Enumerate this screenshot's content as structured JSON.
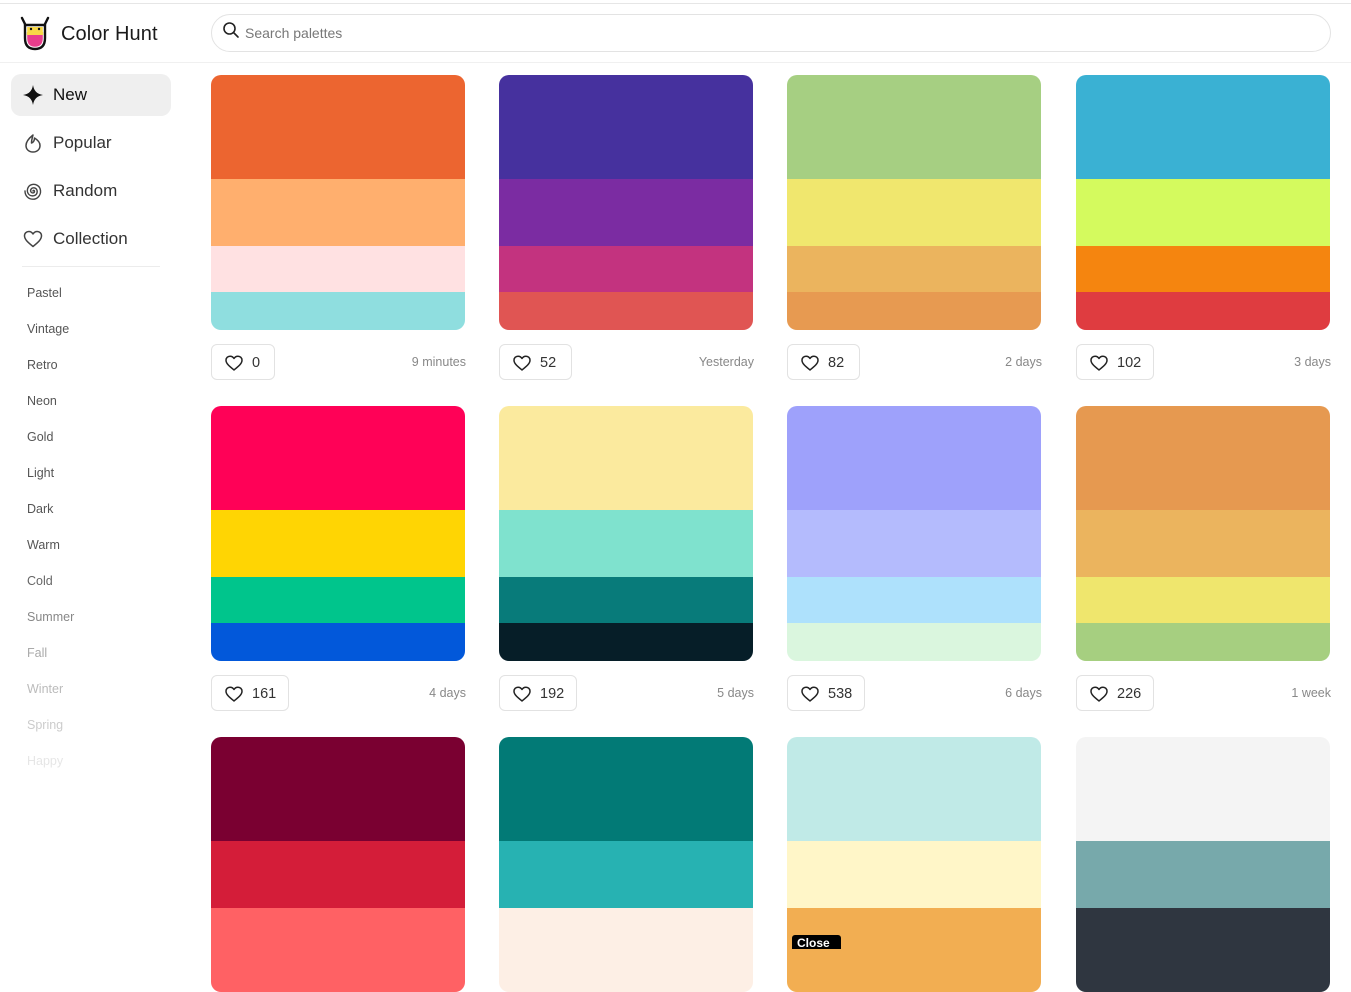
{
  "app": {
    "brand": "Color Hunt"
  },
  "search": {
    "placeholder": "Search palettes"
  },
  "sidebar": {
    "nav": [
      {
        "label": "New",
        "icon": "sparkle-icon",
        "active": true
      },
      {
        "label": "Popular",
        "icon": "flame-icon",
        "active": false
      },
      {
        "label": "Random",
        "icon": "spiral-icon",
        "active": false
      },
      {
        "label": "Collection",
        "icon": "heart-icon",
        "active": false
      }
    ],
    "tags": [
      {
        "label": "Pastel",
        "color": "#555555"
      },
      {
        "label": "Vintage",
        "color": "#555555"
      },
      {
        "label": "Retro",
        "color": "#555555"
      },
      {
        "label": "Neon",
        "color": "#555555"
      },
      {
        "label": "Gold",
        "color": "#555555"
      },
      {
        "label": "Light",
        "color": "#555555"
      },
      {
        "label": "Dark",
        "color": "#555555"
      },
      {
        "label": "Warm",
        "color": "#555555"
      },
      {
        "label": "Cold",
        "color": "#666666"
      },
      {
        "label": "Summer",
        "color": "#888888"
      },
      {
        "label": "Fall",
        "color": "#aaaaaa"
      },
      {
        "label": "Winter",
        "color": "#bbbbbb"
      },
      {
        "label": "Spring",
        "color": "#cccccc"
      },
      {
        "label": "Happy",
        "color": "#e6e6e6"
      }
    ]
  },
  "palettes": [
    {
      "colors": [
        "#EC6530",
        "#FFAF6E",
        "#FFE1E2",
        "#8FDEDF"
      ],
      "likes": "0",
      "date": "9 minutes"
    },
    {
      "colors": [
        "#46319E",
        "#7B2CA2",
        "#C3337F",
        "#E05553"
      ],
      "likes": "52",
      "date": "Yesterday"
    },
    {
      "colors": [
        "#A6CF82",
        "#F0E76E",
        "#EBB45E",
        "#E79A51"
      ],
      "likes": "82",
      "date": "2 days"
    },
    {
      "colors": [
        "#3AB1D3",
        "#D4FA5E",
        "#F5850F",
        "#DF3C40"
      ],
      "likes": "102",
      "date": "3 days"
    },
    {
      "colors": [
        "#FF0157",
        "#FFD503",
        "#00C58C",
        "#0258DA"
      ],
      "likes": "161",
      "date": "4 days"
    },
    {
      "colors": [
        "#FBEA9E",
        "#7FE2CE",
        "#087B7A",
        "#061E28"
      ],
      "likes": "192",
      "date": "5 days"
    },
    {
      "colors": [
        "#9EA1FB",
        "#B4BBFD",
        "#AEE1FC",
        "#DAF6DE"
      ],
      "likes": "538",
      "date": "6 days"
    },
    {
      "colors": [
        "#E69950",
        "#EBB45E",
        "#EFE66D",
        "#A6CF80"
      ],
      "likes": "226",
      "date": "1 week"
    },
    {
      "colors": [
        "#7A0031",
        "#D41D39",
        "#FF6164",
        "#FF6164"
      ],
      "likes": "",
      "date": ""
    },
    {
      "colors": [
        "#027A76",
        "#27B2B2",
        "#FDEFE5",
        "#FDEFE5"
      ],
      "likes": "",
      "date": ""
    },
    {
      "colors": [
        "#C0EAE7",
        "#FFF6C8",
        "#F2AE52",
        "#F2AE52"
      ],
      "likes": "",
      "date": ""
    },
    {
      "colors": [
        "#F4F4F4",
        "#77A9AB",
        "#2F3640",
        "#2F3640"
      ],
      "likes": "",
      "date": ""
    }
  ],
  "overlay": {
    "close_label": "Close"
  }
}
